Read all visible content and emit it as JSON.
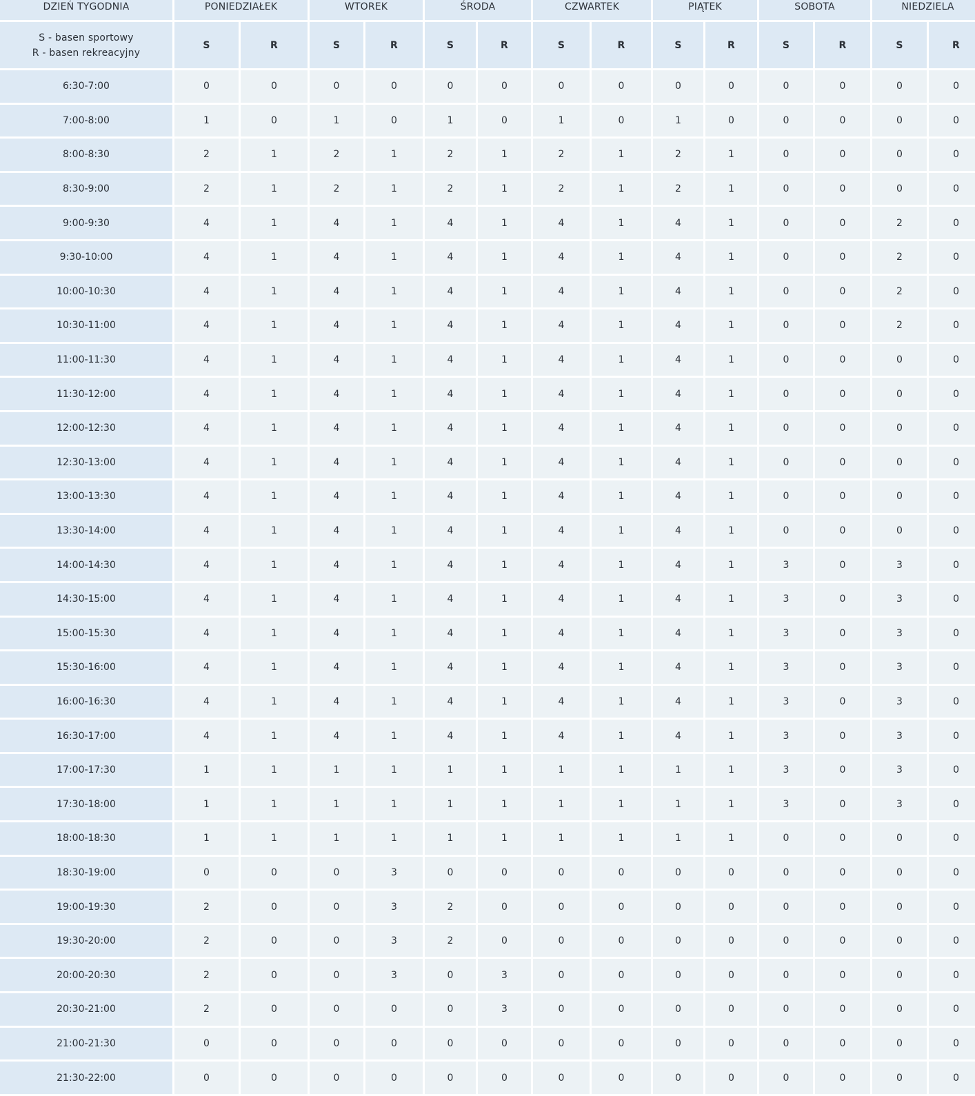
{
  "header": {
    "corner_label": "DZIEŃ TYGODNIA",
    "days": [
      "PONIEDZIAŁEK",
      "WTOREK",
      "ŚRODA",
      "CZWARTEK",
      "PIĄTEK",
      "SOBOTA",
      "NIEDZIELA"
    ],
    "legend_s": "S - basen sportowy",
    "legend_r": "R - basen rekreacyjny",
    "sub_s": "S",
    "sub_r": "R"
  },
  "rows": [
    {
      "time": "6:30-7:00",
      "values": [
        "0",
        "0",
        "0",
        "0",
        "0",
        "0",
        "0",
        "0",
        "0",
        "0",
        "0",
        "0",
        "0",
        "0"
      ]
    },
    {
      "time": "7:00-8:00",
      "values": [
        "1",
        "0",
        "1",
        "0",
        "1",
        "0",
        "1",
        "0",
        "1",
        "0",
        "0",
        "0",
        "0",
        "0"
      ]
    },
    {
      "time": "8:00-8:30",
      "values": [
        "2",
        "1",
        "2",
        "1",
        "2",
        "1",
        "2",
        "1",
        "2",
        "1",
        "0",
        "0",
        "0",
        "0"
      ]
    },
    {
      "time": "8:30-9:00",
      "values": [
        "2",
        "1",
        "2",
        "1",
        "2",
        "1",
        "2",
        "1",
        "2",
        "1",
        "0",
        "0",
        "0",
        "0"
      ]
    },
    {
      "time": "9:00-9:30",
      "values": [
        "4",
        "1",
        "4",
        "1",
        "4",
        "1",
        "4",
        "1",
        "4",
        "1",
        "0",
        "0",
        "2",
        "0"
      ]
    },
    {
      "time": "9:30-10:00",
      "values": [
        "4",
        "1",
        "4",
        "1",
        "4",
        "1",
        "4",
        "1",
        "4",
        "1",
        "0",
        "0",
        "2",
        "0"
      ]
    },
    {
      "time": "10:00-10:30",
      "values": [
        "4",
        "1",
        "4",
        "1",
        "4",
        "1",
        "4",
        "1",
        "4",
        "1",
        "0",
        "0",
        "2",
        "0"
      ]
    },
    {
      "time": "10:30-11:00",
      "values": [
        "4",
        "1",
        "4",
        "1",
        "4",
        "1",
        "4",
        "1",
        "4",
        "1",
        "0",
        "0",
        "2",
        "0"
      ]
    },
    {
      "time": "11:00-11:30",
      "values": [
        "4",
        "1",
        "4",
        "1",
        "4",
        "1",
        "4",
        "1",
        "4",
        "1",
        "0",
        "0",
        "0",
        "0"
      ]
    },
    {
      "time": "11:30-12:00",
      "values": [
        "4",
        "1",
        "4",
        "1",
        "4",
        "1",
        "4",
        "1",
        "4",
        "1",
        "0",
        "0",
        "0",
        "0"
      ]
    },
    {
      "time": "12:00-12:30",
      "values": [
        "4",
        "1",
        "4",
        "1",
        "4",
        "1",
        "4",
        "1",
        "4",
        "1",
        "0",
        "0",
        "0",
        "0"
      ]
    },
    {
      "time": "12:30-13:00",
      "values": [
        "4",
        "1",
        "4",
        "1",
        "4",
        "1",
        "4",
        "1",
        "4",
        "1",
        "0",
        "0",
        "0",
        "0"
      ]
    },
    {
      "time": "13:00-13:30",
      "values": [
        "4",
        "1",
        "4",
        "1",
        "4",
        "1",
        "4",
        "1",
        "4",
        "1",
        "0",
        "0",
        "0",
        "0"
      ]
    },
    {
      "time": "13:30-14:00",
      "values": [
        "4",
        "1",
        "4",
        "1",
        "4",
        "1",
        "4",
        "1",
        "4",
        "1",
        "0",
        "0",
        "0",
        "0"
      ]
    },
    {
      "time": "14:00-14:30",
      "values": [
        "4",
        "1",
        "4",
        "1",
        "4",
        "1",
        "4",
        "1",
        "4",
        "1",
        "3",
        "0",
        "3",
        "0"
      ]
    },
    {
      "time": "14:30-15:00",
      "values": [
        "4",
        "1",
        "4",
        "1",
        "4",
        "1",
        "4",
        "1",
        "4",
        "1",
        "3",
        "0",
        "3",
        "0"
      ]
    },
    {
      "time": "15:00-15:30",
      "values": [
        "4",
        "1",
        "4",
        "1",
        "4",
        "1",
        "4",
        "1",
        "4",
        "1",
        "3",
        "0",
        "3",
        "0"
      ]
    },
    {
      "time": "15:30-16:00",
      "values": [
        "4",
        "1",
        "4",
        "1",
        "4",
        "1",
        "4",
        "1",
        "4",
        "1",
        "3",
        "0",
        "3",
        "0"
      ]
    },
    {
      "time": "16:00-16:30",
      "values": [
        "4",
        "1",
        "4",
        "1",
        "4",
        "1",
        "4",
        "1",
        "4",
        "1",
        "3",
        "0",
        "3",
        "0"
      ]
    },
    {
      "time": "16:30-17:00",
      "values": [
        "4",
        "1",
        "4",
        "1",
        "4",
        "1",
        "4",
        "1",
        "4",
        "1",
        "3",
        "0",
        "3",
        "0"
      ]
    },
    {
      "time": "17:00-17:30",
      "values": [
        "1",
        "1",
        "1",
        "1",
        "1",
        "1",
        "1",
        "1",
        "1",
        "1",
        "3",
        "0",
        "3",
        "0"
      ]
    },
    {
      "time": "17:30-18:00",
      "values": [
        "1",
        "1",
        "1",
        "1",
        "1",
        "1",
        "1",
        "1",
        "1",
        "1",
        "3",
        "0",
        "3",
        "0"
      ]
    },
    {
      "time": "18:00-18:30",
      "values": [
        "1",
        "1",
        "1",
        "1",
        "1",
        "1",
        "1",
        "1",
        "1",
        "1",
        "0",
        "0",
        "0",
        "0"
      ]
    },
    {
      "time": "18:30-19:00",
      "values": [
        "0",
        "0",
        "0",
        "3",
        "0",
        "0",
        "0",
        "0",
        "0",
        "0",
        "0",
        "0",
        "0",
        "0"
      ]
    },
    {
      "time": "19:00-19:30",
      "values": [
        "2",
        "0",
        "0",
        "3",
        "2",
        "0",
        "0",
        "0",
        "0",
        "0",
        "0",
        "0",
        "0",
        "0"
      ]
    },
    {
      "time": "19:30-20:00",
      "values": [
        "2",
        "0",
        "0",
        "3",
        "2",
        "0",
        "0",
        "0",
        "0",
        "0",
        "0",
        "0",
        "0",
        "0"
      ]
    },
    {
      "time": "20:00-20:30",
      "values": [
        "2",
        "0",
        "0",
        "3",
        "0",
        "3",
        "0",
        "0",
        "0",
        "0",
        "0",
        "0",
        "0",
        "0"
      ]
    },
    {
      "time": "20:30-21:00",
      "values": [
        "2",
        "0",
        "0",
        "0",
        "0",
        "3",
        "0",
        "0",
        "0",
        "0",
        "0",
        "0",
        "0",
        "0"
      ]
    },
    {
      "time": "21:00-21:30",
      "values": [
        "0",
        "0",
        "0",
        "0",
        "0",
        "0",
        "0",
        "0",
        "0",
        "0",
        "0",
        "0",
        "0",
        "0"
      ]
    },
    {
      "time": "21:30-22:00",
      "values": [
        "0",
        "0",
        "0",
        "0",
        "0",
        "0",
        "0",
        "0",
        "0",
        "0",
        "0",
        "0",
        "0",
        "0"
      ]
    }
  ]
}
